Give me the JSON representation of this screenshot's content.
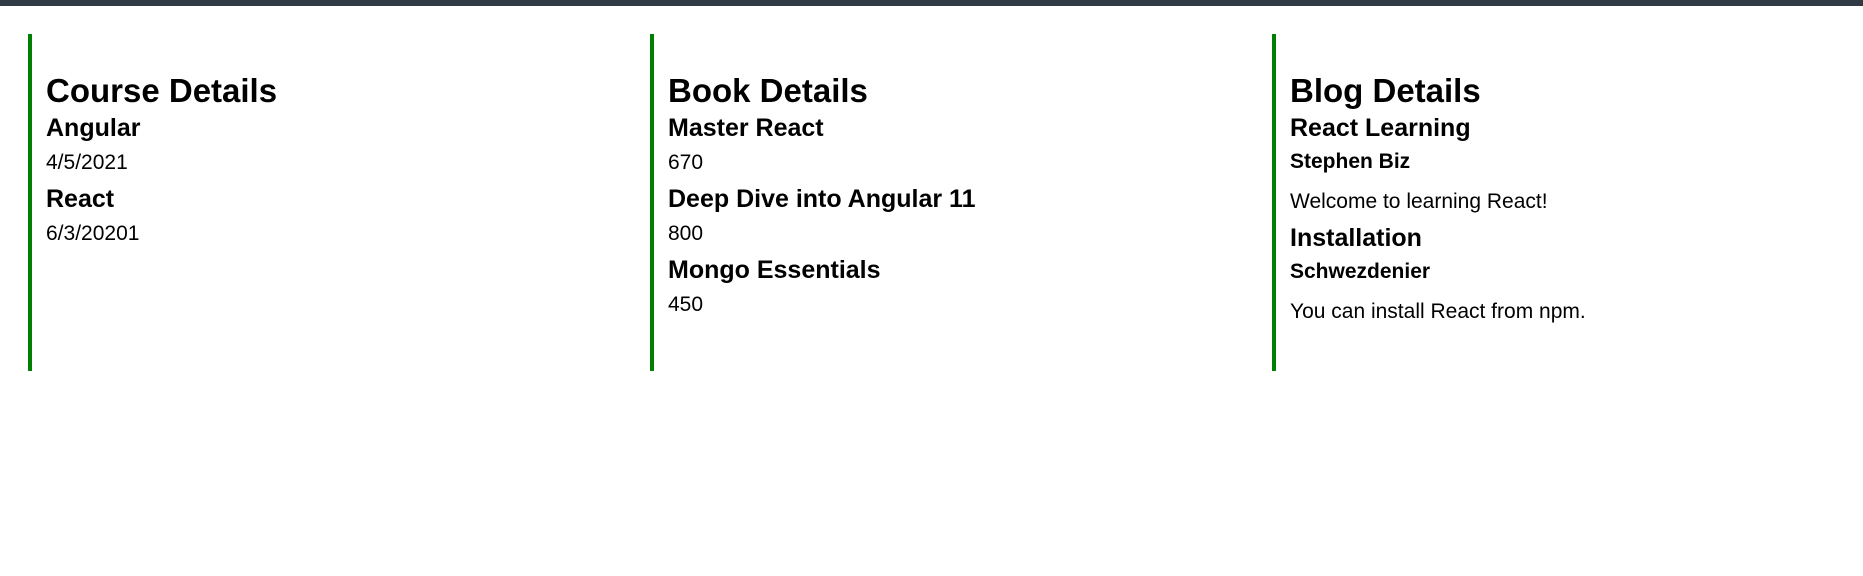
{
  "courses": {
    "title": "Course Details",
    "items": [
      {
        "name": "Angular",
        "date": "4/5/2021"
      },
      {
        "name": "React",
        "date": "6/3/20201"
      }
    ]
  },
  "books": {
    "title": "Book Details",
    "items": [
      {
        "name": "Master React",
        "price": "670"
      },
      {
        "name": "Deep Dive into Angular 11",
        "price": "800"
      },
      {
        "name": "Mongo Essentials",
        "price": "450"
      }
    ]
  },
  "blogs": {
    "title": "Blog Details",
    "items": [
      {
        "title": "React Learning",
        "author": "Stephen Biz",
        "content": "Welcome to learning React!"
      },
      {
        "title": "Installation",
        "author": "Schwezdenier",
        "content": "You can install React from npm."
      }
    ]
  },
  "colors": {
    "panel_border": "#008000",
    "top_bar": "#2f3a45"
  }
}
